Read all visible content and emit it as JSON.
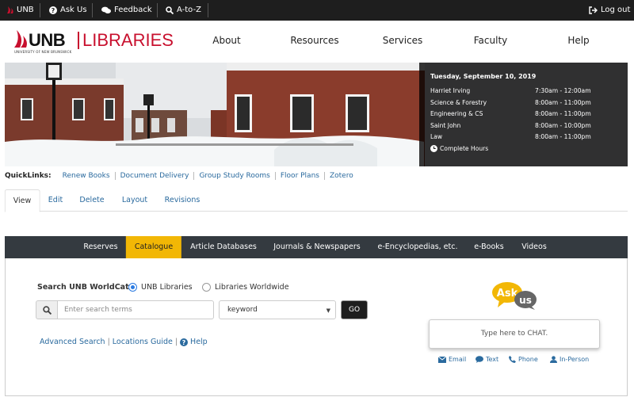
{
  "utility_bar": {
    "unb": "UNB",
    "ask_us": "Ask Us",
    "feedback": "Feedback",
    "atoz": "A-to-Z",
    "logout": "Log out"
  },
  "header": {
    "logo_unb": "UNB",
    "logo_libraries": "LIBRARIES",
    "logo_sub": "UNIVERSITY OF NEW BRUNSWICK",
    "nav": [
      "About",
      "Resources",
      "Services",
      "Faculty",
      "Help"
    ]
  },
  "hours": {
    "date": "Tuesday, September 10, 2019",
    "rows": [
      {
        "name": "Harriet Irving",
        "time": "7:30am - 12:00am"
      },
      {
        "name": "Science & Forestry",
        "time": "8:00am - 11:00pm"
      },
      {
        "name": "Engineering & CS",
        "time": "8:00am - 11:00pm"
      },
      {
        "name": "Saint John",
        "time": "8:00am - 10:00pm"
      },
      {
        "name": "Law",
        "time": "8:00am - 11:00pm"
      }
    ],
    "complete": "Complete Hours"
  },
  "quicklinks": {
    "label": "QuickLinks:",
    "links": [
      "Renew Books",
      "Document Delivery",
      "Group Study Rooms",
      "Floor Plans",
      "Zotero"
    ]
  },
  "admin_tabs": [
    "View",
    "Edit",
    "Delete",
    "Layout",
    "Revisions"
  ],
  "search_tabs": [
    "Reserves",
    "Catalogue",
    "Article Databases",
    "Journals & Newspapers",
    "e-Encyclopedias, etc.",
    "e-Books",
    "Videos"
  ],
  "search": {
    "label": "Search UNB WorldCat:",
    "option_unb": "UNB Libraries",
    "option_world": "Libraries Worldwide",
    "placeholder": "Enter search terms",
    "select_value": "keyword",
    "go": "GO",
    "advanced": "Advanced Search",
    "locations": "Locations Guide",
    "help": "Help",
    "sep": "|"
  },
  "ask": {
    "logo_ask": "Ask",
    "logo_us": "us",
    "chat_placeholder": "Type here to CHAT.",
    "email": "Email",
    "text": "Text",
    "phone": "Phone",
    "in_person": "In-Person"
  },
  "colors": {
    "accent_red": "#c8102e",
    "active_tab": "#f2b705",
    "link": "#2a6a9e",
    "dark_bar": "#1e1e1e"
  }
}
